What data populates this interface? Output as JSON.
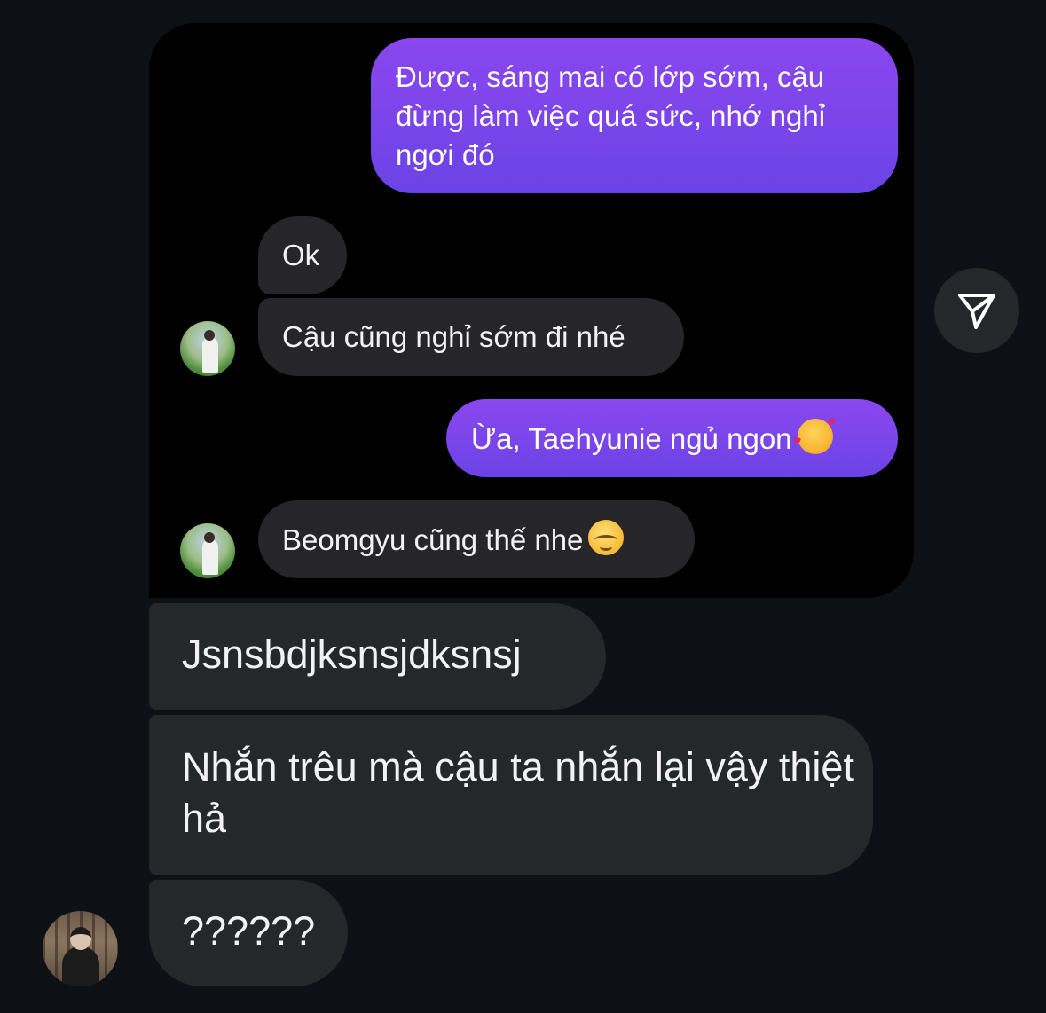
{
  "shared_screenshot": {
    "messages": [
      {
        "side": "sent",
        "text": "Được, sáng mai có lớp sớm, cậu đừng làm việc quá sức, nhớ nghỉ ngơi đó"
      },
      {
        "side": "received",
        "text": "Ok"
      },
      {
        "side": "received",
        "text": "Cậu cũng nghỉ sớm đi nhé"
      },
      {
        "side": "sent",
        "text": "Ừa, Taehyunie ngủ ngon",
        "emoji": "smiling-face-with-hearts-emoji"
      },
      {
        "side": "received",
        "text": "Beomgyu cũng thế nhe",
        "emoji": "smiling-face-emoji"
      }
    ]
  },
  "conversation": {
    "messages": [
      {
        "side": "received",
        "text": "Jsnsbdjksnsjdksnsj"
      },
      {
        "side": "received",
        "text": "Nhắn trêu mà cậu ta nhắn lại vậy thiệt hả"
      },
      {
        "side": "received",
        "text": "??????"
      }
    ]
  },
  "colors": {
    "background": "#0d1116",
    "sent_bubble": "#7a45ea",
    "received_bubble": "#25272b"
  },
  "icons": {
    "share": "paper-plane-icon"
  }
}
